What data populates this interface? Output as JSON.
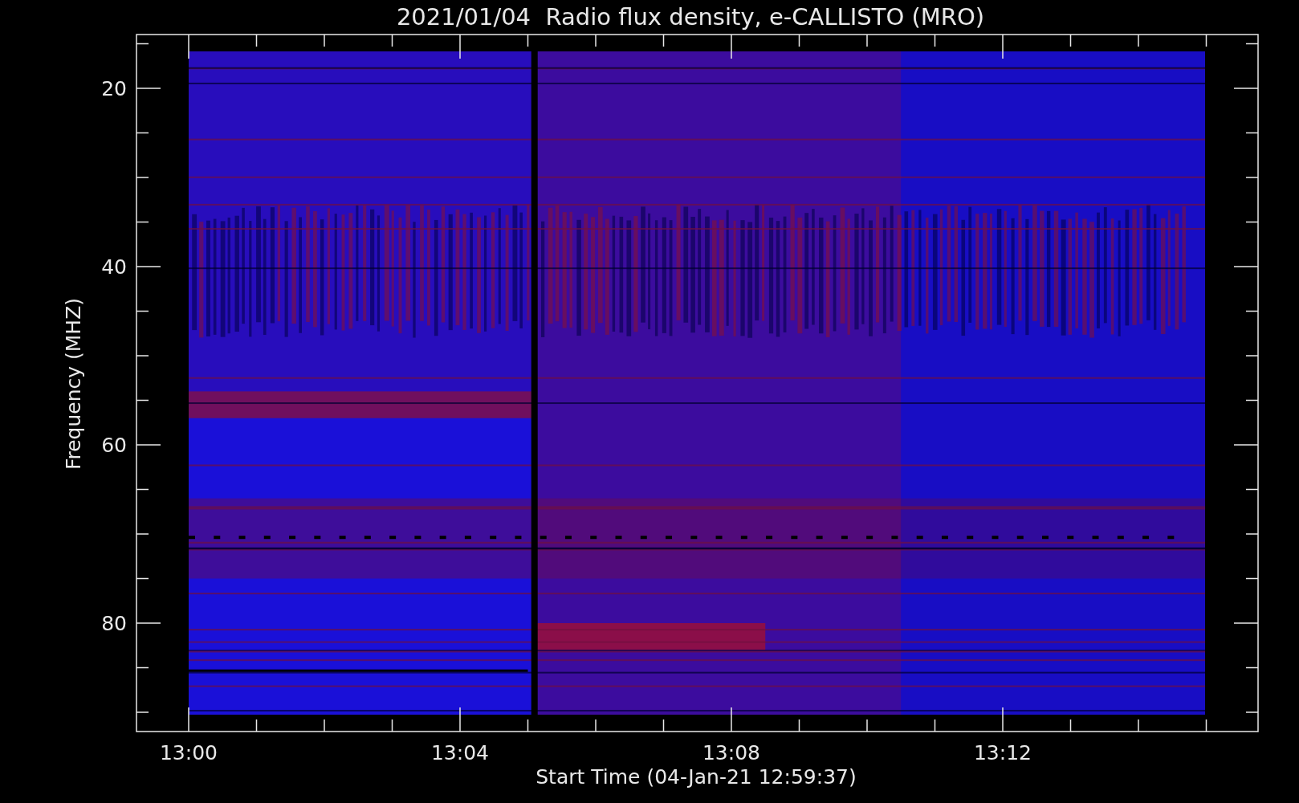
{
  "plot": {
    "title": "2021/01/04  Radio flux density, e-CALLISTO (MRO)",
    "xlabel": "Start Time (04-Jan-21 12:59:37)",
    "ylabel": "Frequency (MHZ)",
    "xticks": [
      "13:00",
      "13:04",
      "13:08",
      "13:12"
    ],
    "yticks": [
      "20",
      "40",
      "60",
      "80"
    ]
  }
}
